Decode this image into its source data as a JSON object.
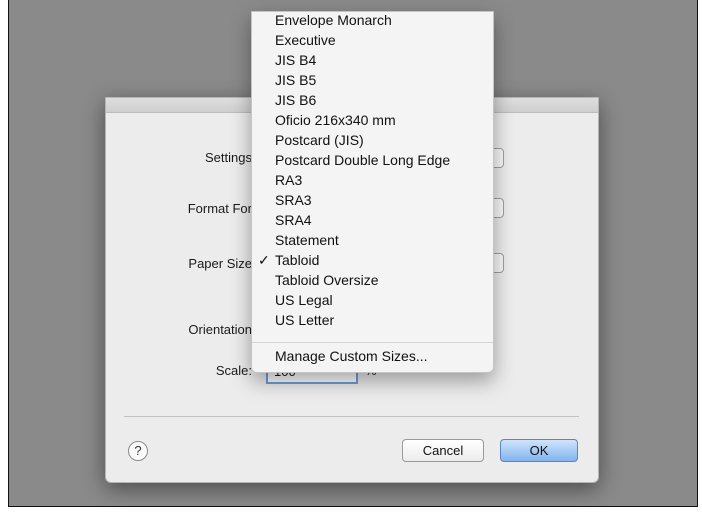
{
  "dialog": {
    "labels": {
      "settings": "Settings",
      "format_for": "Format For",
      "paper_size": "Paper Size",
      "orientation": "Orientation",
      "scale": "Scale:"
    },
    "scale_value": "100",
    "scale_unit": "%",
    "help_label": "?",
    "cancel_label": "Cancel",
    "ok_label": "OK"
  },
  "paper_size_menu": {
    "items": [
      {
        "label": "Envelope Monarch"
      },
      {
        "label": "Executive"
      },
      {
        "label": "JIS B4"
      },
      {
        "label": "JIS B5"
      },
      {
        "label": "JIS B6"
      },
      {
        "label": "Oficio 216x340 mm"
      },
      {
        "label": "Postcard (JIS)"
      },
      {
        "label": "Postcard Double Long Edge"
      },
      {
        "label": "RA3"
      },
      {
        "label": "SRA3"
      },
      {
        "label": "SRA4"
      },
      {
        "label": "Statement"
      },
      {
        "label": "Tabloid",
        "checked": true,
        "check": "✓"
      },
      {
        "label": "Tabloid Oversize"
      },
      {
        "label": "US Legal"
      },
      {
        "label": "US Letter"
      }
    ],
    "manage_label": "Manage Custom Sizes..."
  }
}
